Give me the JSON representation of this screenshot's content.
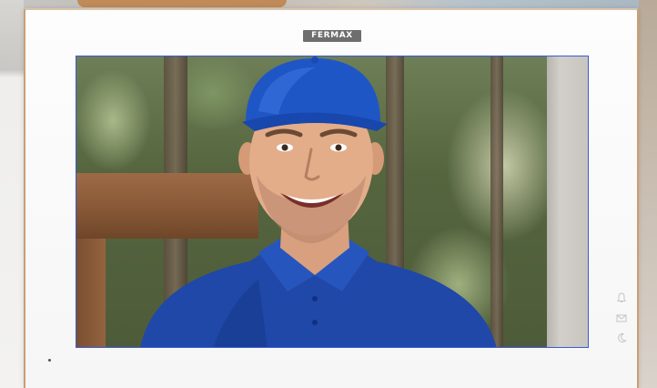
{
  "device": {
    "brand": "FERMAX",
    "colors": {
      "bezel": "#f8f8f8",
      "trim": "#c99f73",
      "screen_border": "#3b5bd6",
      "shirt": "#1f48a8",
      "cap": "#1f56c6"
    }
  },
  "screen": {
    "content": "video-feed"
  },
  "side_indicators": [
    {
      "icon": "bell-icon"
    },
    {
      "icon": "envelope-icon"
    },
    {
      "icon": "moon-icon"
    }
  ]
}
